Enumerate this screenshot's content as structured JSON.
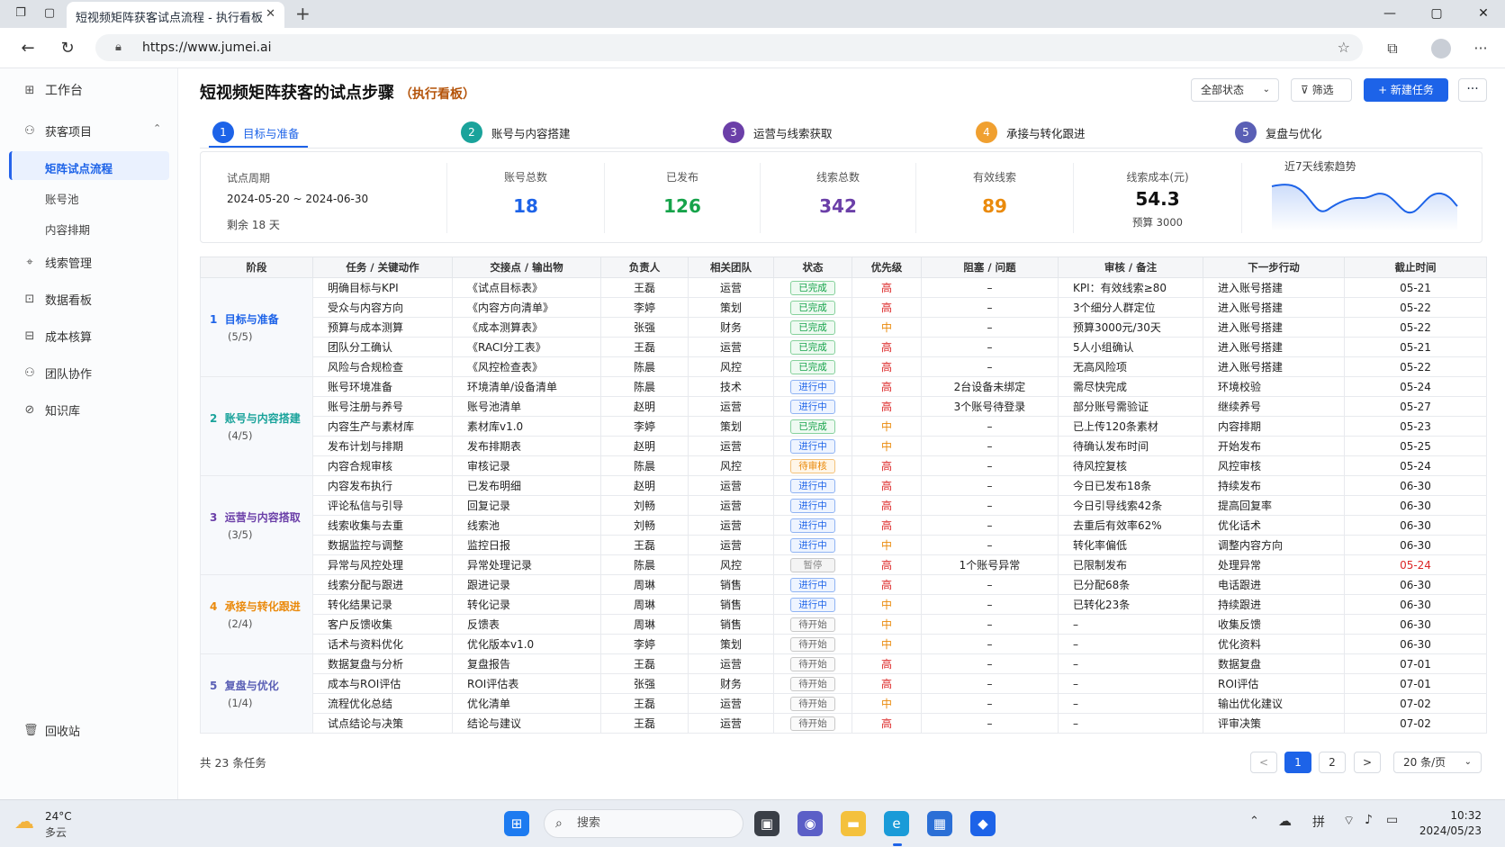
{
  "browser": {
    "tab_title": "短视频矩阵获客试点流程 - 执行看板",
    "url": "https://www.jumei.ai"
  },
  "sidebar": {
    "workspace": "工作台",
    "project_group": "获客项目",
    "sub_items": [
      "矩阵试点流程",
      "账号池",
      "内容排期"
    ],
    "items": [
      "线索管理",
      "数据看板",
      "成本核算",
      "团队协作",
      "知识库"
    ],
    "recycle": "回收站"
  },
  "header": {
    "title": "短视频矩阵获客的试点步骤",
    "subtitle": "（执行看板）",
    "filter_status": "全部状态",
    "filter_btn": "筛选",
    "new_task": "+ 新建任务",
    "more": "···"
  },
  "steps": [
    {
      "num": "1",
      "label": "目标与准备",
      "color": "#1d63e8"
    },
    {
      "num": "2",
      "label": "账号与内容搭建",
      "color": "#1aa39b"
    },
    {
      "num": "3",
      "label": "运营与线索获取",
      "color": "#6b3fa8"
    },
    {
      "num": "4",
      "label": "承接与转化跟进",
      "color": "#f0a030"
    },
    {
      "num": "5",
      "label": "复盘与优化",
      "color": "#5a5fb5"
    }
  ],
  "stats": {
    "period_label": "试点周期",
    "period_value": "2024-05-20 ~ 2024-06-30",
    "remaining": "剩余 18 天",
    "accounts_label": "账号总数",
    "accounts": "18",
    "published_label": "已发布",
    "published": "126",
    "leads_label": "线索总数",
    "leads": "342",
    "valid_label": "有效线索",
    "valid": "89",
    "cost_label": "线索成本(元)",
    "cost": "54.3",
    "budget": "预算  3000",
    "trend_label": "近7天线索趋势"
  },
  "table": {
    "headers": [
      "阶段",
      "任务 / 关键动作",
      "交接点 / 输出物",
      "负责人",
      "相关团队",
      "状态",
      "优先级",
      "阻塞 / 问题",
      "审核 / 备注",
      "下一步行动",
      "截止时间"
    ],
    "stages": [
      {
        "num": "1",
        "name": "目标与准备",
        "count": "(5/5)",
        "color": "#1d63e8",
        "rows": 5
      },
      {
        "num": "2",
        "name": "账号与内容搭建",
        "count": "(4/5)",
        "color": "#1aa39b",
        "rows": 5
      },
      {
        "num": "3",
        "name": "运营与内容搭取",
        "count": "(3/5)",
        "color": "#6b3fa8",
        "rows": 5
      },
      {
        "num": "4",
        "name": "承接与转化跟进",
        "count": "(2/4)",
        "color": "#ea8a0c",
        "rows": 4
      },
      {
        "num": "5",
        "name": "复盘与优化",
        "count": "(1/4)",
        "color": "#5a5fb5",
        "rows": 4
      }
    ],
    "rows": [
      [
        "明确目标与KPI",
        "《试点目标表》",
        "王磊",
        "运营",
        "已完成",
        "高",
        "–",
        "KPI：有效线索≥80",
        "进入账号搭建",
        "05-21"
      ],
      [
        "受众与内容方向",
        "《内容方向清单》",
        "李婷",
        "策划",
        "已完成",
        "高",
        "–",
        "3个细分人群定位",
        "进入账号搭建",
        "05-22"
      ],
      [
        "预算与成本测算",
        "《成本测算表》",
        "张强",
        "财务",
        "已完成",
        "中",
        "–",
        "预算3000元/30天",
        "进入账号搭建",
        "05-22"
      ],
      [
        "团队分工确认",
        "《RACI分工表》",
        "王磊",
        "运营",
        "已完成",
        "高",
        "–",
        "5人小组确认",
        "进入账号搭建",
        "05-21"
      ],
      [
        "风险与合规检查",
        "《风控检查表》",
        "陈晨",
        "风控",
        "已完成",
        "高",
        "–",
        "无高风险项",
        "进入账号搭建",
        "05-22"
      ],
      [
        "账号环境准备",
        "环境清单/设备清单",
        "陈晨",
        "技术",
        "进行中",
        "高",
        "2台设备未绑定",
        "需尽快完成",
        "环境校验",
        "05-24"
      ],
      [
        "账号注册与养号",
        "账号池清单",
        "赵明",
        "运营",
        "进行中",
        "高",
        "3个账号待登录",
        "部分账号需验证",
        "继续养号",
        "05-27"
      ],
      [
        "内容生产与素材库",
        "素材库v1.0",
        "李婷",
        "策划",
        "已完成",
        "中",
        "–",
        "已上传120条素材",
        "内容排期",
        "05-23"
      ],
      [
        "发布计划与排期",
        "发布排期表",
        "赵明",
        "运营",
        "进行中",
        "中",
        "–",
        "待确认发布时间",
        "开始发布",
        "05-25"
      ],
      [
        "内容合规审核",
        "审核记录",
        "陈晨",
        "风控",
        "待审核",
        "高",
        "–",
        "待风控复核",
        "风控审核",
        "05-24"
      ],
      [
        "内容发布执行",
        "已发布明细",
        "赵明",
        "运营",
        "进行中",
        "高",
        "–",
        "今日已发布18条",
        "持续发布",
        "06-30"
      ],
      [
        "评论私信与引导",
        "回复记录",
        "刘畅",
        "运营",
        "进行中",
        "高",
        "–",
        "今日引导线索42条",
        "提高回复率",
        "06-30"
      ],
      [
        "线索收集与去重",
        "线索池",
        "刘畅",
        "运营",
        "进行中",
        "高",
        "–",
        "去重后有效率62%",
        "优化话术",
        "06-30"
      ],
      [
        "数据监控与调整",
        "监控日报",
        "王磊",
        "运营",
        "进行中",
        "中",
        "–",
        "转化率偏低",
        "调整内容方向",
        "06-30"
      ],
      [
        "异常与风控处理",
        "异常处理记录",
        "陈晨",
        "风控",
        "暂停",
        "高",
        "1个账号异常",
        "已限制发布",
        "处理异常",
        "05-24"
      ],
      [
        "线索分配与跟进",
        "跟进记录",
        "周琳",
        "销售",
        "进行中",
        "高",
        "–",
        "已分配68条",
        "电话跟进",
        "06-30"
      ],
      [
        "转化结果记录",
        "转化记录",
        "周琳",
        "销售",
        "进行中",
        "中",
        "–",
        "已转化23条",
        "持续跟进",
        "06-30"
      ],
      [
        "客户反馈收集",
        "反馈表",
        "周琳",
        "销售",
        "待开始",
        "中",
        "–",
        "–",
        "收集反馈",
        "06-30"
      ],
      [
        "话术与资料优化",
        "优化版本v1.0",
        "李婷",
        "策划",
        "待开始",
        "中",
        "–",
        "–",
        "优化资料",
        "06-30"
      ],
      [
        "数据复盘与分析",
        "复盘报告",
        "王磊",
        "运营",
        "待开始",
        "高",
        "–",
        "–",
        "数据复盘",
        "07-01"
      ],
      [
        "成本与ROI评估",
        "ROI评估表",
        "张强",
        "财务",
        "待开始",
        "高",
        "–",
        "–",
        "ROI评估",
        "07-01"
      ],
      [
        "流程优化总结",
        "优化清单",
        "王磊",
        "运营",
        "待开始",
        "中",
        "–",
        "–",
        "输出优化建议",
        "07-02"
      ],
      [
        "试点结论与决策",
        "结论与建议",
        "王磊",
        "运营",
        "待开始",
        "高",
        "–",
        "–",
        "评审决策",
        "07-02"
      ]
    ],
    "red_due_row": 14
  },
  "footer": {
    "total": "共 23 条任务",
    "prev": "<",
    "page1": "1",
    "page2": "2",
    "next": ">",
    "page_size": "20 条/页"
  },
  "taskbar": {
    "temp": "24°C",
    "weather": "多云",
    "search": "搜索",
    "time": "10:32",
    "date": "2024/05/23"
  },
  "colors": {
    "accent": "#1d63e8",
    "done": "#16a34a",
    "high": "#dc2626",
    "mid": "#ea8a0c"
  }
}
